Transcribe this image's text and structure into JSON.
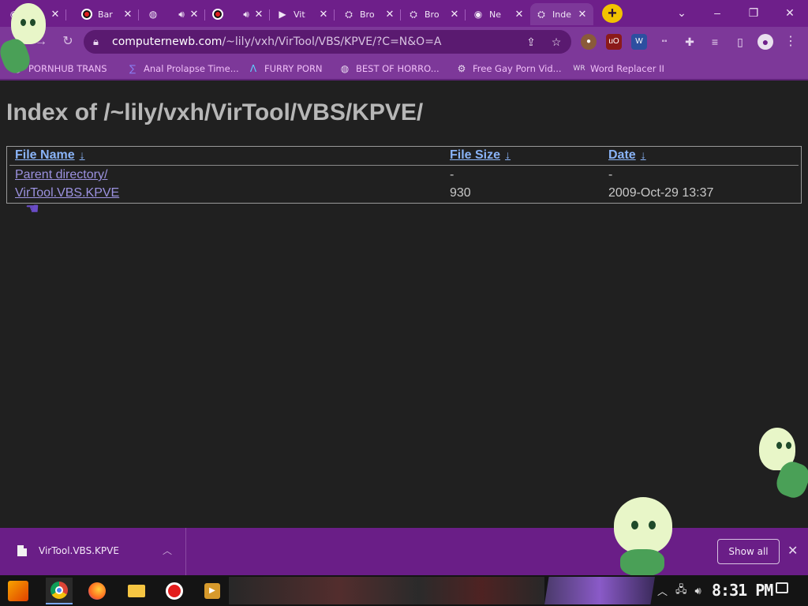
{
  "browser": {
    "tabs": [
      {
        "label": "",
        "icon": "chrome-icon",
        "active": false
      },
      {
        "label": "Bar",
        "icon": "record-icon",
        "active": false
      },
      {
        "label": "",
        "icon": "globe-icon",
        "active": false,
        "audio": true
      },
      {
        "label": "",
        "icon": "record-icon",
        "active": false,
        "audio": true
      },
      {
        "label": "Vit",
        "icon": "play-icon",
        "active": false
      },
      {
        "label": "Bro",
        "icon": "ufo-icon",
        "active": false
      },
      {
        "label": "Bro",
        "icon": "ufo-icon",
        "active": false
      },
      {
        "label": "Ne",
        "icon": "chrome-icon",
        "active": false
      },
      {
        "label": "Inde",
        "icon": "folder-icon",
        "active": true
      }
    ],
    "new_tab_label": "+",
    "omnibox": {
      "host": "computernewb.com",
      "path": "/~lily/vxh/VirTool/VBS/KPVE/?C=N&O=A"
    },
    "bookmarks": [
      {
        "label": "PORNHUB TRANS",
        "icon": "globe-icon"
      },
      {
        "label": "Anal Prolapse Time...",
        "icon": "bookmark-icon"
      },
      {
        "label": "FURRY PORN",
        "icon": "lambda-icon"
      },
      {
        "label": "BEST OF HORRO...",
        "icon": "globe-icon"
      },
      {
        "label": "Free Gay Porn Vid...",
        "icon": "robot-icon"
      },
      {
        "label": "Word Replacer II",
        "icon": "wr-icon"
      }
    ],
    "theme_color": "#7d3899"
  },
  "page": {
    "title": "Index of /~lily/vxh/VirTool/VBS/KPVE/",
    "columns": [
      {
        "label": "File Name",
        "sort": "↓"
      },
      {
        "label": "File Size",
        "sort": "↓"
      },
      {
        "label": "Date",
        "sort": "↓"
      }
    ],
    "rows": [
      {
        "name": "Parent directory/",
        "size": "-",
        "date": "-"
      },
      {
        "name": "VirTool.VBS.KPVE",
        "size": "930",
        "date": "2009-Oct-29 13:37"
      }
    ],
    "link_color": "#8ab4f8"
  },
  "download_bar": {
    "file_name": "VirTool.VBS.KPVE",
    "show_all_label": "Show all"
  },
  "taskbar": {
    "clock": "8:31 PM"
  }
}
